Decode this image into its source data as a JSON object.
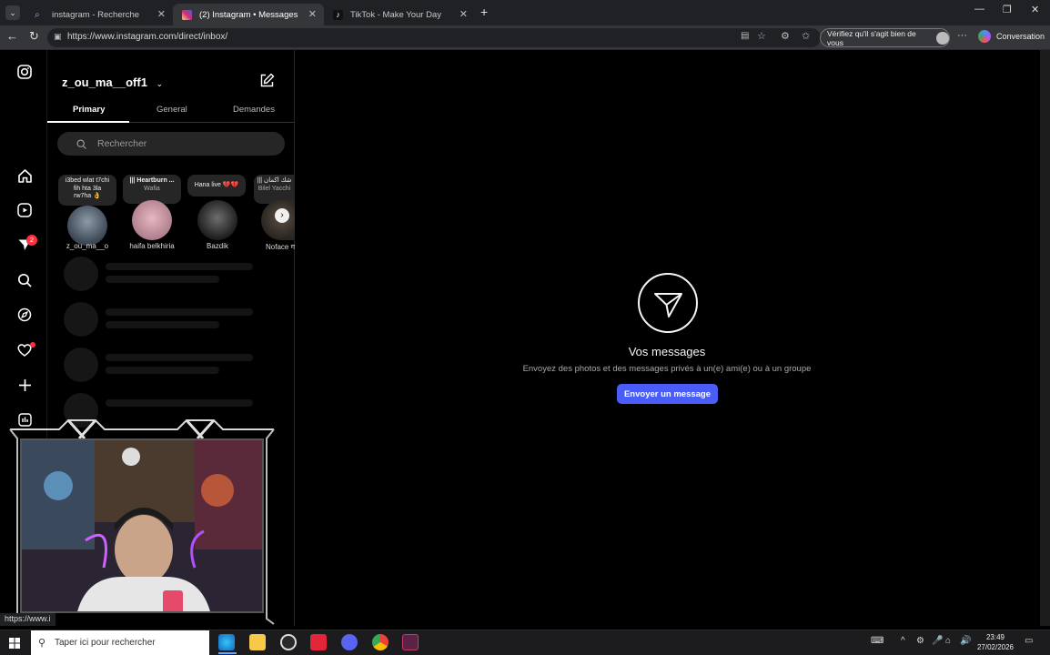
{
  "browser": {
    "tabs": [
      {
        "title": "instagram - Recherche",
        "active": false
      },
      {
        "title": "(2) Instagram • Messages",
        "active": true
      },
      {
        "title": "TikTok - Make Your Day",
        "active": false
      }
    ],
    "url": "https://www.instagram.com/direct/inbox/",
    "verify_label": "Vérifiez qu'il s'agit bien de vous",
    "conversation_label": "Conversation",
    "status_url": "https://www.i"
  },
  "instagram": {
    "username": "z_ou_ma__off1",
    "inbox_tabs": [
      "Primary",
      "General",
      "Demandes"
    ],
    "search_placeholder": "Rechercher",
    "notification_count": "2",
    "notes": [
      {
        "note_lines": [
          "i3bed wlat t7chi",
          "fih hta 3la",
          "rw7ha 👌"
        ],
        "name": "z_ou_ma__o"
      },
      {
        "note_lines": [
          "||| Heartburn ...",
          "Wafia"
        ],
        "name": "haifa belkhiria"
      },
      {
        "note_lines": [
          "Hana live 💔💔"
        ],
        "name": "Bazdik"
      },
      {
        "note_lines": [
          "||| شك اكمان",
          "Bilel Yacchi"
        ],
        "name": "Noface ग"
      }
    ],
    "empty_state": {
      "title": "Vos messages",
      "description": "Envoyez des photos et des messages privés à un(e) ami(e) ou à un groupe",
      "button": "Envoyer un message"
    }
  },
  "taskbar": {
    "search_placeholder": "Taper ici pour rechercher",
    "time": "23:49",
    "date": "27/02/2026"
  },
  "colors": {
    "accent": "#4a5df9",
    "badge": "#ff3040"
  }
}
